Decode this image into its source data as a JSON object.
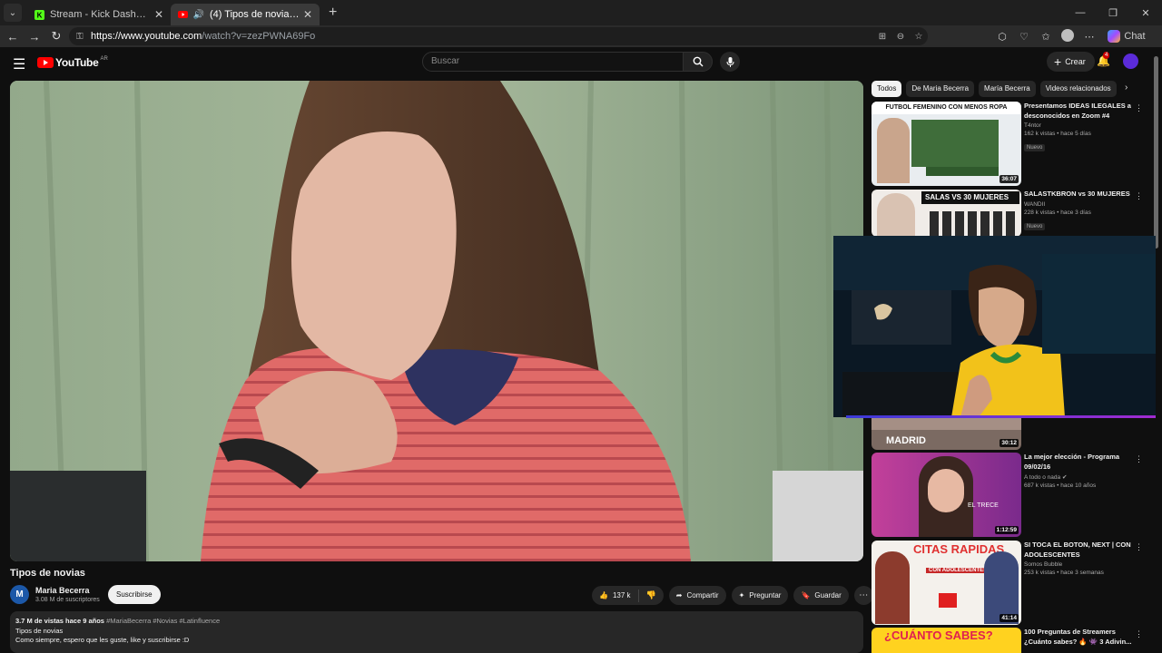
{
  "browser": {
    "tabs": [
      {
        "title": "Stream - Kick Dashboard",
        "active": false
      },
      {
        "title": "(4) Tipos de novias - YouTube",
        "active": true
      }
    ],
    "url_host": "https://www.youtube.com",
    "url_rest": "/watch?v=zezPWNA69Fo",
    "chat_label": "Chat"
  },
  "yt_header": {
    "logo_text": "YouTube",
    "country_code": "AR",
    "search_placeholder": "Buscar",
    "create_label": "Crear",
    "notif_count": "4"
  },
  "video": {
    "title": "Tipos de novias",
    "channel": "Maria Becerra",
    "channel_initial": "M",
    "subscribers": "3.08 M de suscriptores",
    "subscribe_label": "Suscribirse",
    "likes": "137 k",
    "share_label": "Compartir",
    "ask_label": "Preguntar",
    "save_label": "Guardar"
  },
  "description": {
    "stats": "3.7 M de vistas  hace 9 años",
    "tags": "#MariaBecerra #Novias #Latinfluence",
    "line1": "Tipos de novias",
    "line2": "Como siempre, espero que les guste, like y suscribirse :D"
  },
  "chips": [
    "Todos",
    "De Maria Becerra",
    "María Becerra",
    "Videos relacionados"
  ],
  "recommendations": [
    {
      "title": "Presentamos IDEAS ILEGALES a desconocidos en Zoom #4",
      "channel": "T4ntor",
      "views": "162 k vistas • hace 5 días",
      "badge": "Nuevo",
      "duration": "36:07",
      "thumb_text": "FUTBOL FEMENINO CON MENOS ROPA"
    },
    {
      "title": "SALASTKBRON vs 30 MUJERES",
      "channel": "WANDII",
      "views": "228 k vistas • hace 3 días",
      "badge": "Nuevo",
      "duration": "",
      "thumb_text": "SALAS VS 30 MUJERES"
    },
    {
      "title": "",
      "channel": "",
      "views": "",
      "badge": "",
      "duration": "30:12",
      "thumb_text": "MADRID"
    },
    {
      "title": "La mejor elección - Programa 09/02/16",
      "channel": "A todo o nada",
      "views": "687 k vistas • hace 10 años",
      "badge": "",
      "duration": "1:12:59",
      "thumb_text": "EL TRECE"
    },
    {
      "title": "SI TOCA EL BOTON, NEXT | CON ADOLESCENTES",
      "channel": "Somos Bubble",
      "views": "253 k vistas • hace 3 semanas",
      "badge": "",
      "duration": "41:14",
      "thumb_text": "CITAS RAPIDAS"
    },
    {
      "title": "100 Preguntas de Streamers ¿Cuánto sabes? 🔥 👾 3 Adivin...",
      "channel": "",
      "views": "",
      "badge": "",
      "duration": "",
      "thumb_text": "¿CUÁNTO SABES?"
    }
  ],
  "thumb_extra": {
    "thumb2_sub": "CON ADOLESCENTES"
  },
  "colors": {
    "page_bg": "#0f0f0f",
    "brand_red": "#ff0000",
    "chip_bg": "#272727",
    "overlay_accent": "#a12bd1"
  }
}
